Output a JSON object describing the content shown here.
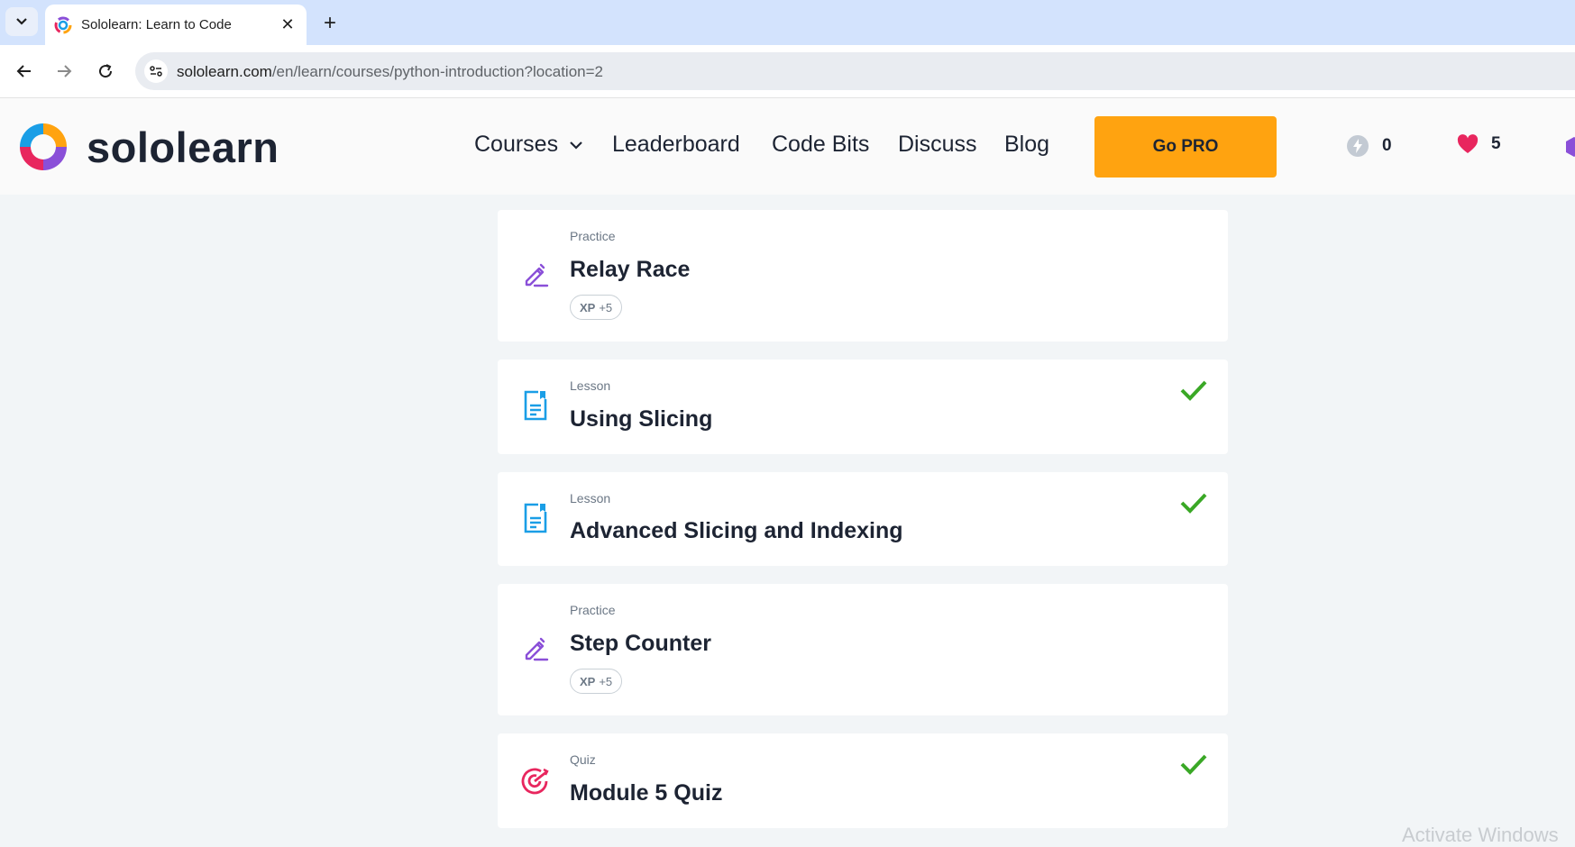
{
  "browser": {
    "tab_title": "Sololearn: Learn to Code",
    "url_host": "sololearn.com",
    "url_path": "/en/learn/courses/python-introduction?location=2",
    "new_tab_symbol": "+",
    "close_symbol": "✕"
  },
  "header": {
    "logo_text": "sololearn",
    "nav": [
      "Courses",
      "Leaderboard",
      "Code Bits",
      "Discuss",
      "Blog"
    ],
    "go_pro": "Go PRO",
    "energy_count": "0",
    "hearts_count": "5"
  },
  "cards": [
    {
      "type": "Practice",
      "title": "Relay Race",
      "xp_label": "XP",
      "xp_value": "+5",
      "icon": "pencil-icon",
      "completed": false
    },
    {
      "type": "Lesson",
      "title": "Using Slicing",
      "icon": "lesson-document-icon",
      "completed": true
    },
    {
      "type": "Lesson",
      "title": "Advanced Slicing and Indexing",
      "icon": "lesson-document-icon",
      "completed": true
    },
    {
      "type": "Practice",
      "title": "Step Counter",
      "xp_label": "XP",
      "xp_value": "+5",
      "icon": "pencil-icon",
      "completed": false
    },
    {
      "type": "Quiz",
      "title": "Module 5 Quiz",
      "icon": "target-icon",
      "completed": true
    }
  ],
  "watermark": "Activate Windows",
  "colors": {
    "accent_orange": "#ffa310",
    "practice_purple": "#8a4fd8",
    "lesson_blue": "#1a9ee6",
    "quiz_red": "#e8265e",
    "check_green": "#3aa826"
  }
}
